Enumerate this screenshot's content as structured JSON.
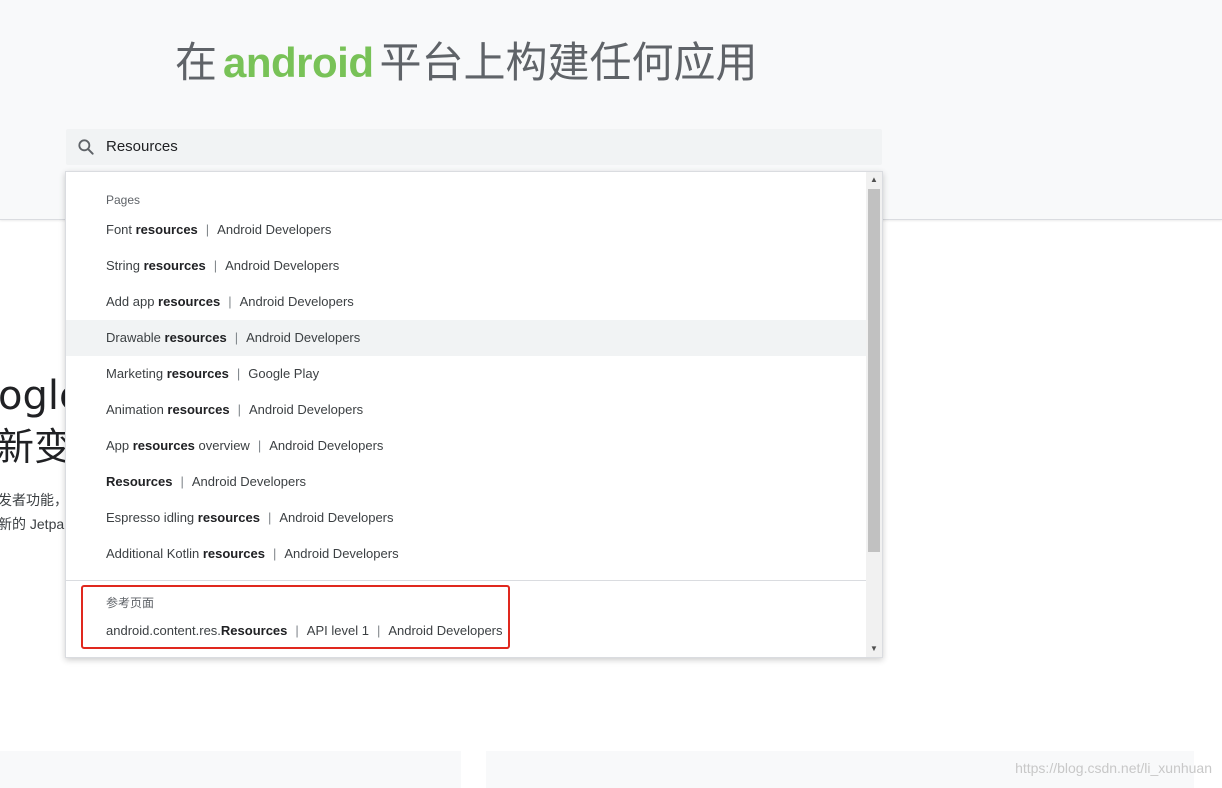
{
  "hero": {
    "title_prefix": "在",
    "title_brand": "android",
    "title_suffix": "平台上构建任何应用"
  },
  "search": {
    "value": "Resources",
    "icon": "search-icon"
  },
  "background": {
    "heading": "ogle",
    "subheading": "新变",
    "para_line1": "发者功能，",
    "para_line2": "新的 Jetpa"
  },
  "dropdown": {
    "pages_label": "Pages",
    "results": [
      {
        "pre": "Font ",
        "bold": "resources",
        "post": "",
        "source": "Android Developers"
      },
      {
        "pre": "String ",
        "bold": "resources",
        "post": "",
        "source": "Android Developers"
      },
      {
        "pre": "Add app ",
        "bold": "resources",
        "post": "",
        "source": "Android Developers"
      },
      {
        "pre": "Drawable ",
        "bold": "resources",
        "post": "",
        "source": "Android Developers"
      },
      {
        "pre": "Marketing ",
        "bold": "resources",
        "post": "",
        "source": "Google Play"
      },
      {
        "pre": "Animation ",
        "bold": "resources",
        "post": "",
        "source": "Android Developers"
      },
      {
        "pre": "App ",
        "bold": "resources",
        "post": " overview",
        "source": "Android Developers"
      },
      {
        "pre": "",
        "bold": "Resources",
        "post": "",
        "source": "Android Developers"
      },
      {
        "pre": "Espresso idling ",
        "bold": "resources",
        "post": "",
        "source": "Android Developers"
      },
      {
        "pre": "Additional Kotlin ",
        "bold": "resources",
        "post": "",
        "source": "Android Developers"
      }
    ],
    "reference_label": "参考页面",
    "reference_result": {
      "pre": "android.content.res.",
      "bold": "Resources",
      "mid": "API level 1",
      "source": "Android Developers"
    },
    "separator": "|"
  },
  "watermark": "https://blog.csdn.net/li_xunhuan"
}
